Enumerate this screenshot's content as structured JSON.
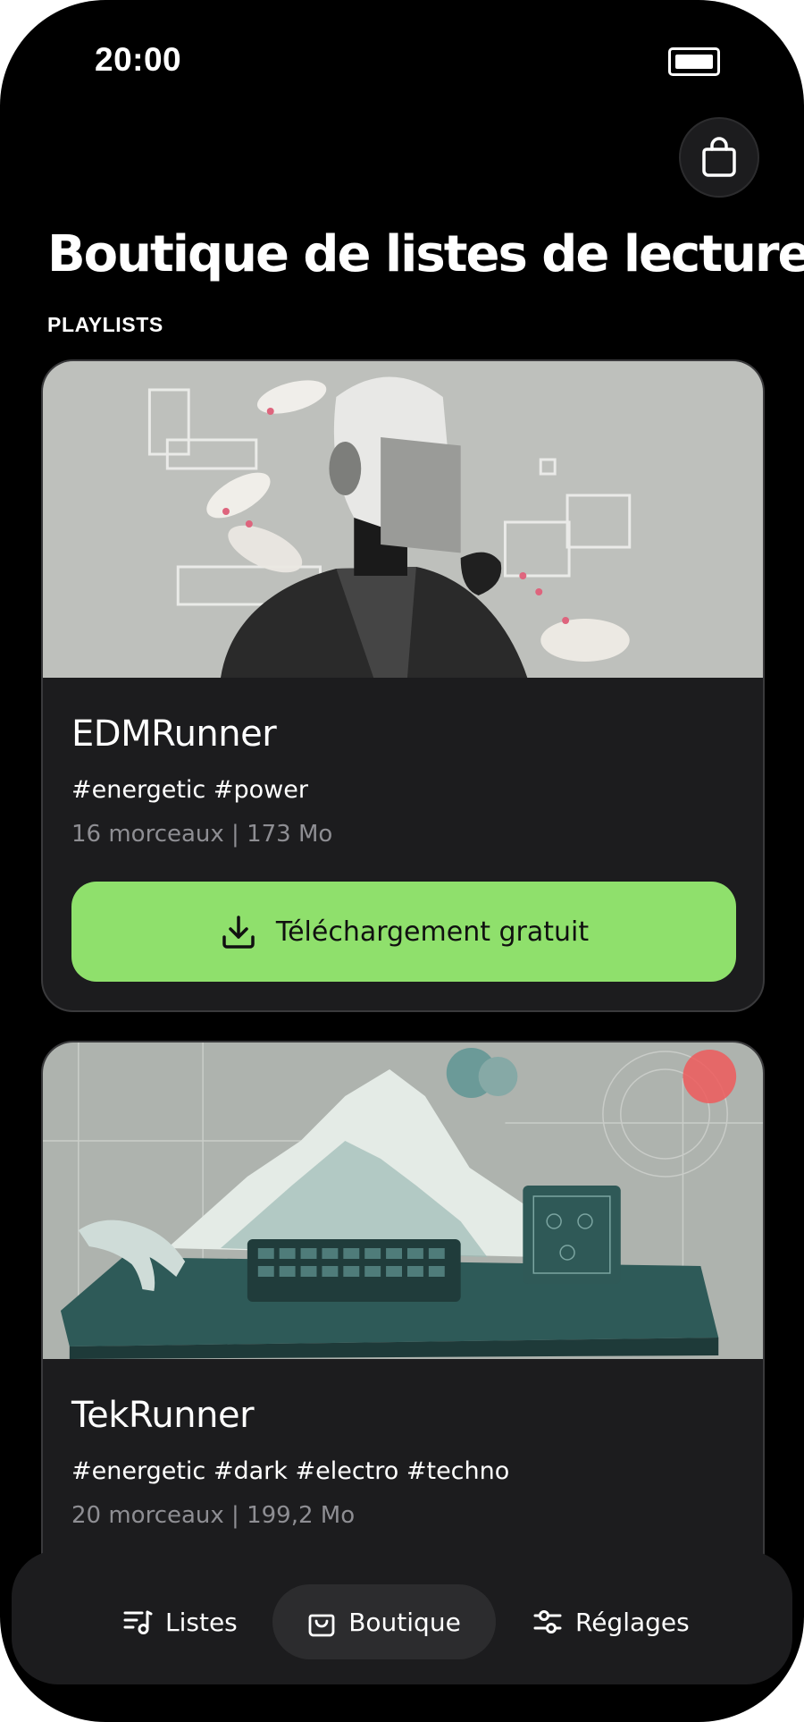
{
  "status": {
    "time": "20:00"
  },
  "header": {
    "title": "Boutique de listes de lecture",
    "section_label": "PLAYLISTS"
  },
  "playlists": [
    {
      "name": "EDMRunner",
      "tags": "#energetic #power",
      "meta": "16 morceaux | 173 Mo",
      "action_label": "Téléchargement gratuit"
    },
    {
      "name": "TekRunner",
      "tags": "#energetic #dark #electro #techno",
      "meta": "20 morceaux | 199,2 Mo"
    }
  ],
  "tabs": [
    {
      "label": "Listes",
      "icon": "playlist-icon",
      "active": false
    },
    {
      "label": "Boutique",
      "icon": "shopping-bag-icon",
      "active": true
    },
    {
      "label": "Réglages",
      "icon": "sliders-icon",
      "active": false
    }
  ],
  "colors": {
    "background": "#000000",
    "card": "#1c1c1e",
    "accent_button": "#8fe06c",
    "muted_text": "#8e8e93",
    "active_tab": "#2c2c2e"
  }
}
